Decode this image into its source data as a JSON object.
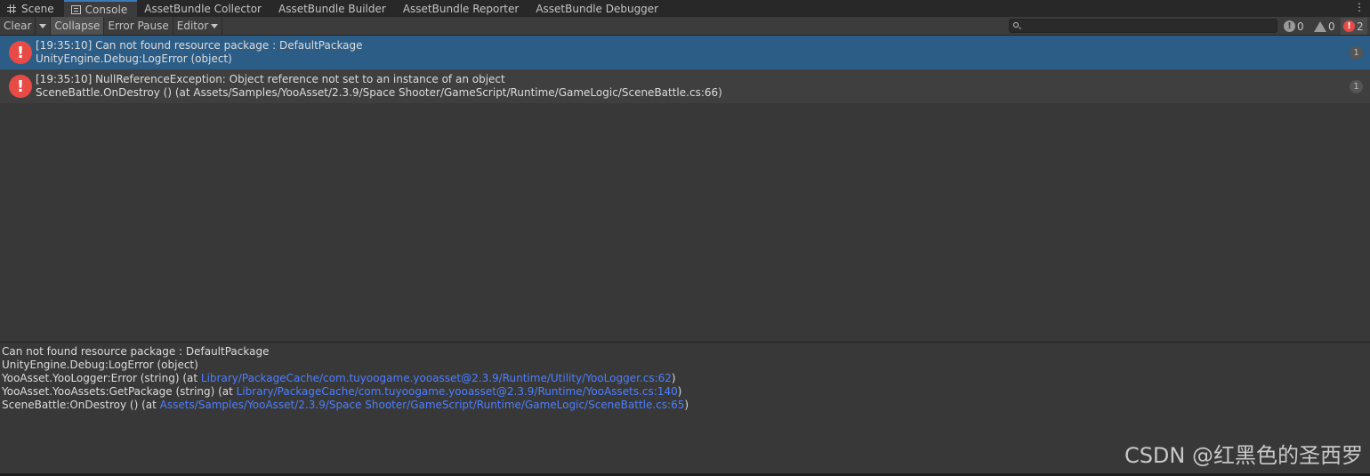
{
  "tabs": [
    {
      "label": "Scene",
      "icon": "grid-icon",
      "active": false
    },
    {
      "label": "Console",
      "icon": "console-icon",
      "active": true
    },
    {
      "label": "AssetBundle Collector",
      "active": false
    },
    {
      "label": "AssetBundle Builder",
      "active": false
    },
    {
      "label": "AssetBundle Reporter",
      "active": false
    },
    {
      "label": "AssetBundle Debugger",
      "active": false
    }
  ],
  "toolbar": {
    "clear": "Clear",
    "collapse": "Collapse",
    "error_pause": "Error Pause",
    "editor": "Editor",
    "search_placeholder": "",
    "info_count": "0",
    "warn_count": "0",
    "error_count": "2"
  },
  "logs": [
    {
      "line1": "[19:35:10] Can not found resource package : DefaultPackage",
      "line2": "UnityEngine.Debug:LogError (object)",
      "count": "1",
      "selected": true
    },
    {
      "line1": "[19:35:10] NullReferenceException: Object reference not set to an instance of an object",
      "line2": "SceneBattle.OnDestroy () (at Assets/Samples/YooAsset/2.3.9/Space Shooter/GameScript/Runtime/GameLogic/SceneBattle.cs:66)",
      "count": "1",
      "selected": false
    }
  ],
  "detail": {
    "line1": "Can not found resource package : DefaultPackage",
    "line2": "UnityEngine.Debug:LogError (object)",
    "line3_prefix": "YooAsset.YooLogger:Error (string) (at ",
    "line3_link": "Library/PackageCache/com.tuyoogame.yooasset@2.3.9/Runtime/Utility/YooLogger.cs:62",
    "line3_suffix": ")",
    "line4_prefix": "YooAsset.YooAssets:GetPackage (string) (at ",
    "line4_link": "Library/PackageCache/com.tuyoogame.yooasset@2.3.9/Runtime/YooAssets.cs:140",
    "line4_suffix": ")",
    "line5_prefix": "SceneBattle:OnDestroy () (at ",
    "line5_link": "Assets/Samples/YooAsset/2.3.9/Space Shooter/GameScript/Runtime/GameLogic/SceneBattle.cs:65",
    "line5_suffix": ")"
  },
  "watermark": "CSDN @红黑色的圣西罗",
  "colors": {
    "selection": "#2c5d87",
    "error": "#e84a45",
    "link": "#4c7fff"
  }
}
